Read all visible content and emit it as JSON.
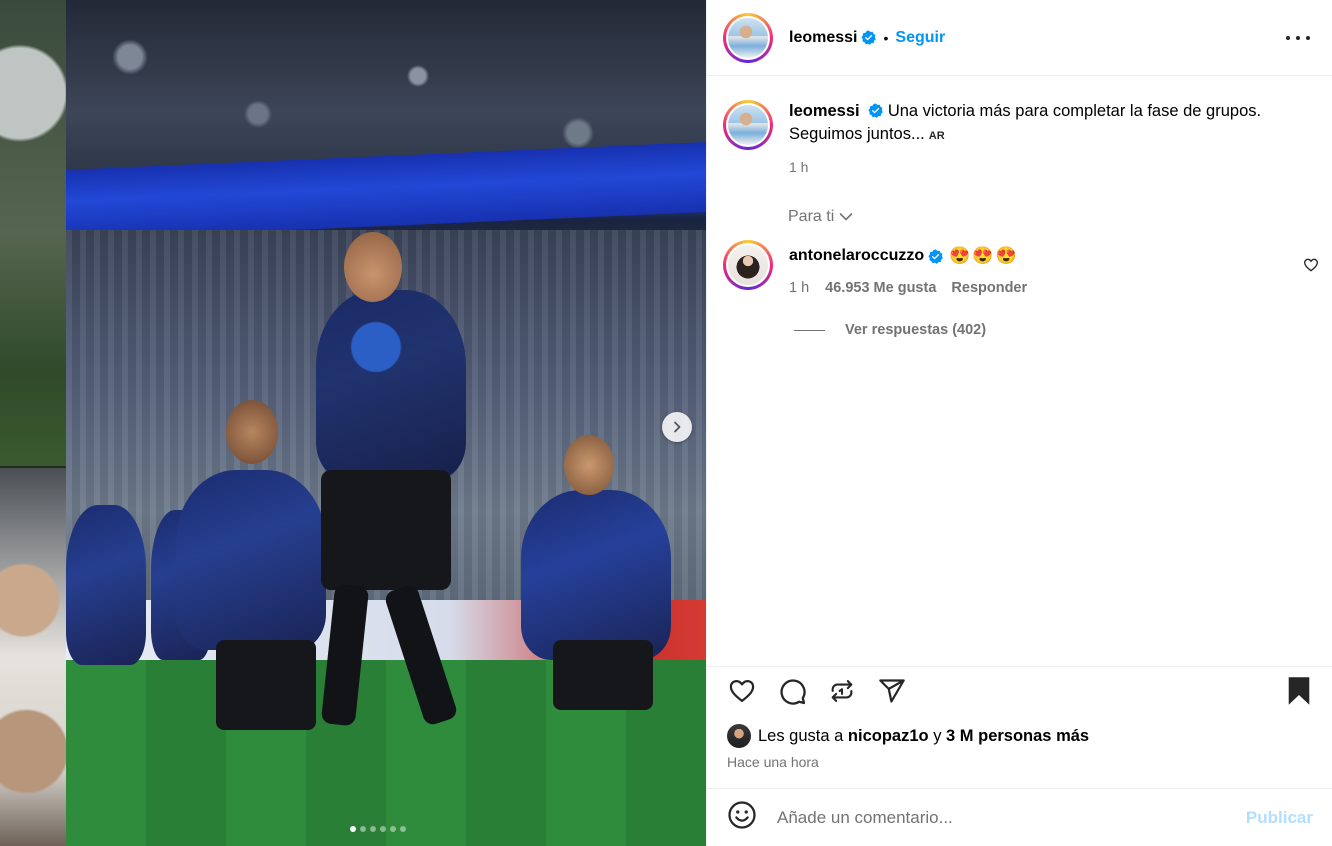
{
  "post": {
    "author": "leomessi",
    "follow_label": "Seguir",
    "bullet": "•",
    "caption_line1": "Una victoria más para completar la fase de grupos.",
    "caption_line2": "Seguimos juntos...",
    "language_tag": "AR",
    "caption_time": "1 h",
    "sort_label": "Para ti",
    "image_count": 6,
    "image_index": 1
  },
  "comment": {
    "author": "antonelaroccuzzo",
    "text": "😍😍😍",
    "time": "1 h",
    "likes": "46.953 Me gusta",
    "reply_label": "Responder",
    "view_replies": "Ver respuestas (402)"
  },
  "engagement": {
    "liked_by_prefix": "Les gusta a",
    "liked_by_user": "nicopaz1o",
    "liked_by_conj": "y",
    "liked_by_rest": "3 M personas más",
    "posted_ago": "Hace una hora"
  },
  "composer": {
    "placeholder": "Añade un comentario...",
    "publish_label": "Publicar"
  },
  "colors": {
    "accent": "#0095f6",
    "publish_disabled": "#b2dffc",
    "muted": "#737373"
  }
}
